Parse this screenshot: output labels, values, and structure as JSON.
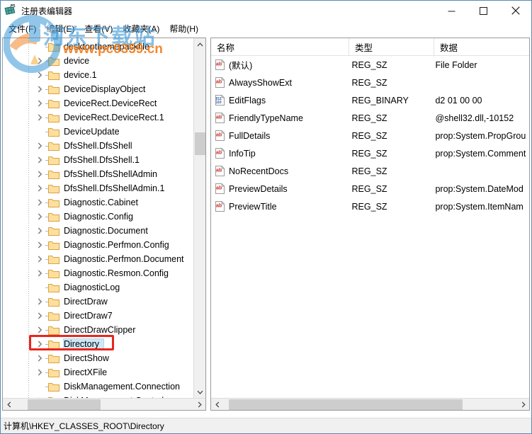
{
  "window": {
    "title": "注册表编辑器",
    "app_icon": "registry-editor-icon",
    "controls": {
      "minimize": "−",
      "maximize": "□",
      "close": "✕"
    }
  },
  "menubar": {
    "items": [
      {
        "label": "文件(F)"
      },
      {
        "label": "编辑(E)"
      },
      {
        "label": "查看(V)"
      },
      {
        "label": "收藏夹(A)"
      },
      {
        "label": "帮助(H)"
      }
    ]
  },
  "tree": {
    "items": [
      {
        "label": "desktopthemepackfile",
        "expandable": false,
        "selected": false
      },
      {
        "label": "device",
        "expandable": true,
        "selected": false
      },
      {
        "label": "device.1",
        "expandable": true,
        "selected": false
      },
      {
        "label": "DeviceDisplayObject",
        "expandable": true,
        "selected": false
      },
      {
        "label": "DeviceRect.DeviceRect",
        "expandable": true,
        "selected": false
      },
      {
        "label": "DeviceRect.DeviceRect.1",
        "expandable": true,
        "selected": false
      },
      {
        "label": "DeviceUpdate",
        "expandable": false,
        "selected": false
      },
      {
        "label": "DfsShell.DfsShell",
        "expandable": true,
        "selected": false
      },
      {
        "label": "DfsShell.DfsShell.1",
        "expandable": true,
        "selected": false
      },
      {
        "label": "DfsShell.DfsShellAdmin",
        "expandable": true,
        "selected": false
      },
      {
        "label": "DfsShell.DfsShellAdmin.1",
        "expandable": true,
        "selected": false
      },
      {
        "label": "Diagnostic.Cabinet",
        "expandable": true,
        "selected": false
      },
      {
        "label": "Diagnostic.Config",
        "expandable": true,
        "selected": false
      },
      {
        "label": "Diagnostic.Document",
        "expandable": true,
        "selected": false
      },
      {
        "label": "Diagnostic.Perfmon.Config",
        "expandable": true,
        "selected": false
      },
      {
        "label": "Diagnostic.Perfmon.Document",
        "expandable": true,
        "selected": false
      },
      {
        "label": "Diagnostic.Resmon.Config",
        "expandable": true,
        "selected": false
      },
      {
        "label": "DiagnosticLog",
        "expandable": false,
        "selected": false
      },
      {
        "label": "DirectDraw",
        "expandable": true,
        "selected": false
      },
      {
        "label": "DirectDraw7",
        "expandable": true,
        "selected": false
      },
      {
        "label": "DirectDrawClipper",
        "expandable": true,
        "selected": false
      },
      {
        "label": "Directory",
        "expandable": true,
        "selected": true
      },
      {
        "label": "DirectShow",
        "expandable": true,
        "selected": false
      },
      {
        "label": "DirectXFile",
        "expandable": true,
        "selected": false
      },
      {
        "label": "DiskManagement.Connection",
        "expandable": false,
        "selected": false
      },
      {
        "label": "DiskManagement.Control",
        "expandable": true,
        "selected": false
      }
    ]
  },
  "list": {
    "columns": [
      {
        "label": "名称"
      },
      {
        "label": "类型"
      },
      {
        "label": "数据"
      }
    ],
    "rows": [
      {
        "name": "(默认)",
        "icon": "string-value-icon",
        "type": "REG_SZ",
        "data": "File Folder"
      },
      {
        "name": "AlwaysShowExt",
        "icon": "string-value-icon",
        "type": "REG_SZ",
        "data": ""
      },
      {
        "name": "EditFlags",
        "icon": "binary-value-icon",
        "type": "REG_BINARY",
        "data": "d2 01 00 00"
      },
      {
        "name": "FriendlyTypeName",
        "icon": "string-value-icon",
        "type": "REG_SZ",
        "data": "@shell32.dll,-10152"
      },
      {
        "name": "FullDetails",
        "icon": "string-value-icon",
        "type": "REG_SZ",
        "data": "prop:System.PropGrou"
      },
      {
        "name": "InfoTip",
        "icon": "string-value-icon",
        "type": "REG_SZ",
        "data": "prop:System.Comment"
      },
      {
        "name": "NoRecentDocs",
        "icon": "string-value-icon",
        "type": "REG_SZ",
        "data": ""
      },
      {
        "name": "PreviewDetails",
        "icon": "string-value-icon",
        "type": "REG_SZ",
        "data": "prop:System.DateMod"
      },
      {
        "name": "PreviewTitle",
        "icon": "string-value-icon",
        "type": "REG_SZ",
        "data": "prop:System.ItemNam"
      }
    ]
  },
  "statusbar": {
    "path": "计算机\\HKEY_CLASSES_ROOT\\Directory"
  },
  "watermark": {
    "cn_text": "河东下载站",
    "url_text": "www.pc0359.cn"
  },
  "colors": {
    "selection": "#cde8f7",
    "annotation": "#e8251f",
    "folder": "#ffd98a",
    "watermark_blue": "#3d9ad9",
    "watermark_orange": "#f08020"
  }
}
